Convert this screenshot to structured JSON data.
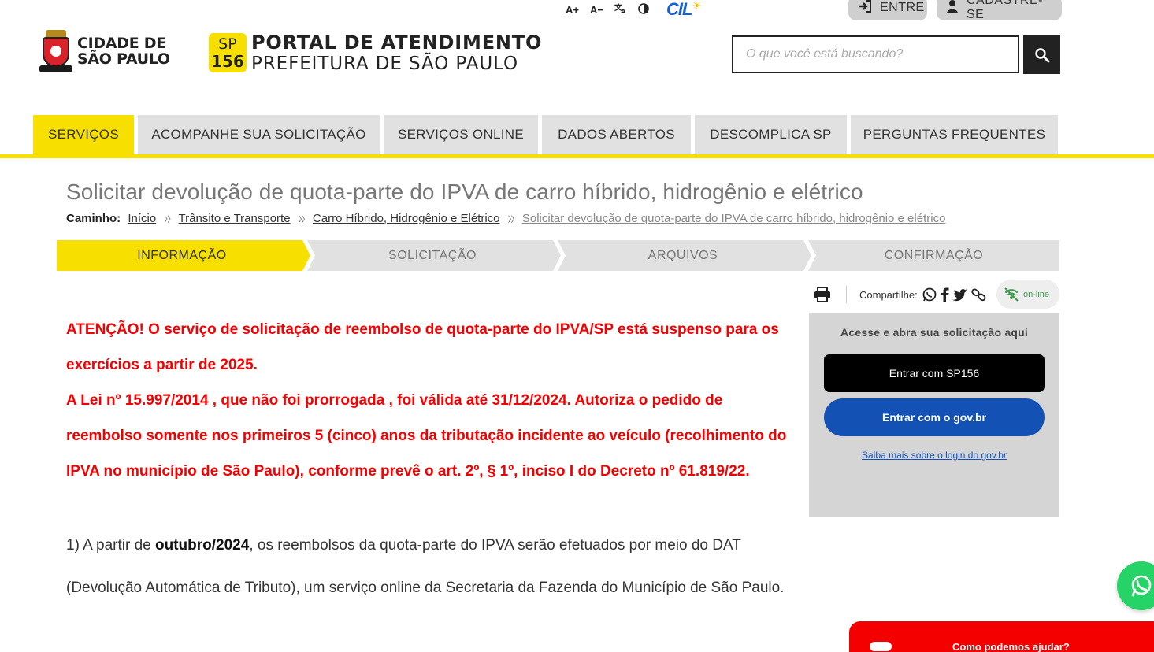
{
  "accessibility": {
    "font_increase": "A+",
    "font_decrease": "A−",
    "translate_icon": "translate-icon",
    "contrast_icon": "contrast-icon",
    "cil_logo": "CIL"
  },
  "account": {
    "login_label": "ENTRE",
    "register_label": "CADASTRE-SE"
  },
  "brand": {
    "cidade_line1": "CIDADE DE",
    "cidade_line2": "SÃO PAULO",
    "sp_badge_top": "SP",
    "sp_badge_bottom": "156",
    "portal_line1": "PORTAL DE ATENDIMENTO",
    "portal_line2": "PREFEITURA DE SÃO PAULO",
    "yellow": "#f7e000"
  },
  "search": {
    "placeholder": "O que você está buscando?",
    "value": ""
  },
  "nav": {
    "items": [
      {
        "label": "SERVIÇOS",
        "active": true
      },
      {
        "label": "ACOMPANHE SUA SOLICITAÇÃO",
        "active": false
      },
      {
        "label": "SERVIÇOS ONLINE",
        "active": false
      },
      {
        "label": "DADOS ABERTOS",
        "active": false
      },
      {
        "label": "DESCOMPLICA SP",
        "active": false
      },
      {
        "label": "PERGUNTAS FREQUENTES",
        "active": false
      }
    ]
  },
  "page": {
    "title": "Solicitar devolução de quota-parte do IPVA de carro híbrido, hidrogênio e elétrico"
  },
  "breadcrumb": {
    "label": "Caminho:",
    "separator": "〉〉",
    "items": [
      "Início",
      "Trânsito e Transporte",
      "Carro Híbrido, Hidrogênio e Elétrico",
      "Solicitar devolução de quota-parte do IPVA de carro híbrido, hidrogênio e elétrico"
    ]
  },
  "steps": [
    {
      "label": "INFORMAÇÃO",
      "active": true
    },
    {
      "label": "SOLICITAÇÃO",
      "active": false
    },
    {
      "label": "ARQUIVOS",
      "active": false
    },
    {
      "label": "CONFIRMAÇÃO",
      "active": false
    }
  ],
  "share": {
    "label": "Compartilhe:",
    "online_label": "on-line",
    "icons": [
      "print-icon",
      "whatsapp-icon",
      "facebook-icon",
      "twitter-icon",
      "link-icon",
      "online-icon"
    ]
  },
  "notice": {
    "line1": "ATENÇÃO!  O serviço de solicitação de reembolso de quota-parte do IPVA/SP está suspenso para os exercícios a partir de  2025.",
    "line2": "A Lei nº 15.997/2014 , que não foi prorrogada , foi  válida  até  31/12/2024. Autoriza o pedido de reembolso somente nos primeiros 5 (cinco) anos da tributação incidente ao veículo (recolhimento do IPVA no município de São Paulo), conforme prevê o art.  2º, § 1º, inciso I do Decreto nº 61.819/22.",
    "color": "#f50000"
  },
  "body": {
    "p1_prefix": "1) A partir de ",
    "p1_bold": "outubro/2024",
    "p1_suffix": ", os reembolsos da quota-parte do IPVA serão efetuados por meio do DAT (Devolução Automática de Tributo), um serviço online da Secretaria da Fazenda do Município de São Paulo."
  },
  "login_panel": {
    "title": "Acesse e abra sua solicitação aqui",
    "sp156_button": "Entrar com SP156",
    "govbr_button": "Entrar com o gov.br",
    "govbr_link": "Saiba mais sobre o login do gov.br",
    "govbr_color": "#1351b4"
  },
  "floating": {
    "whatsapp_icon": "whatsapp-icon",
    "help_label": "Como podemos ajudar?"
  }
}
